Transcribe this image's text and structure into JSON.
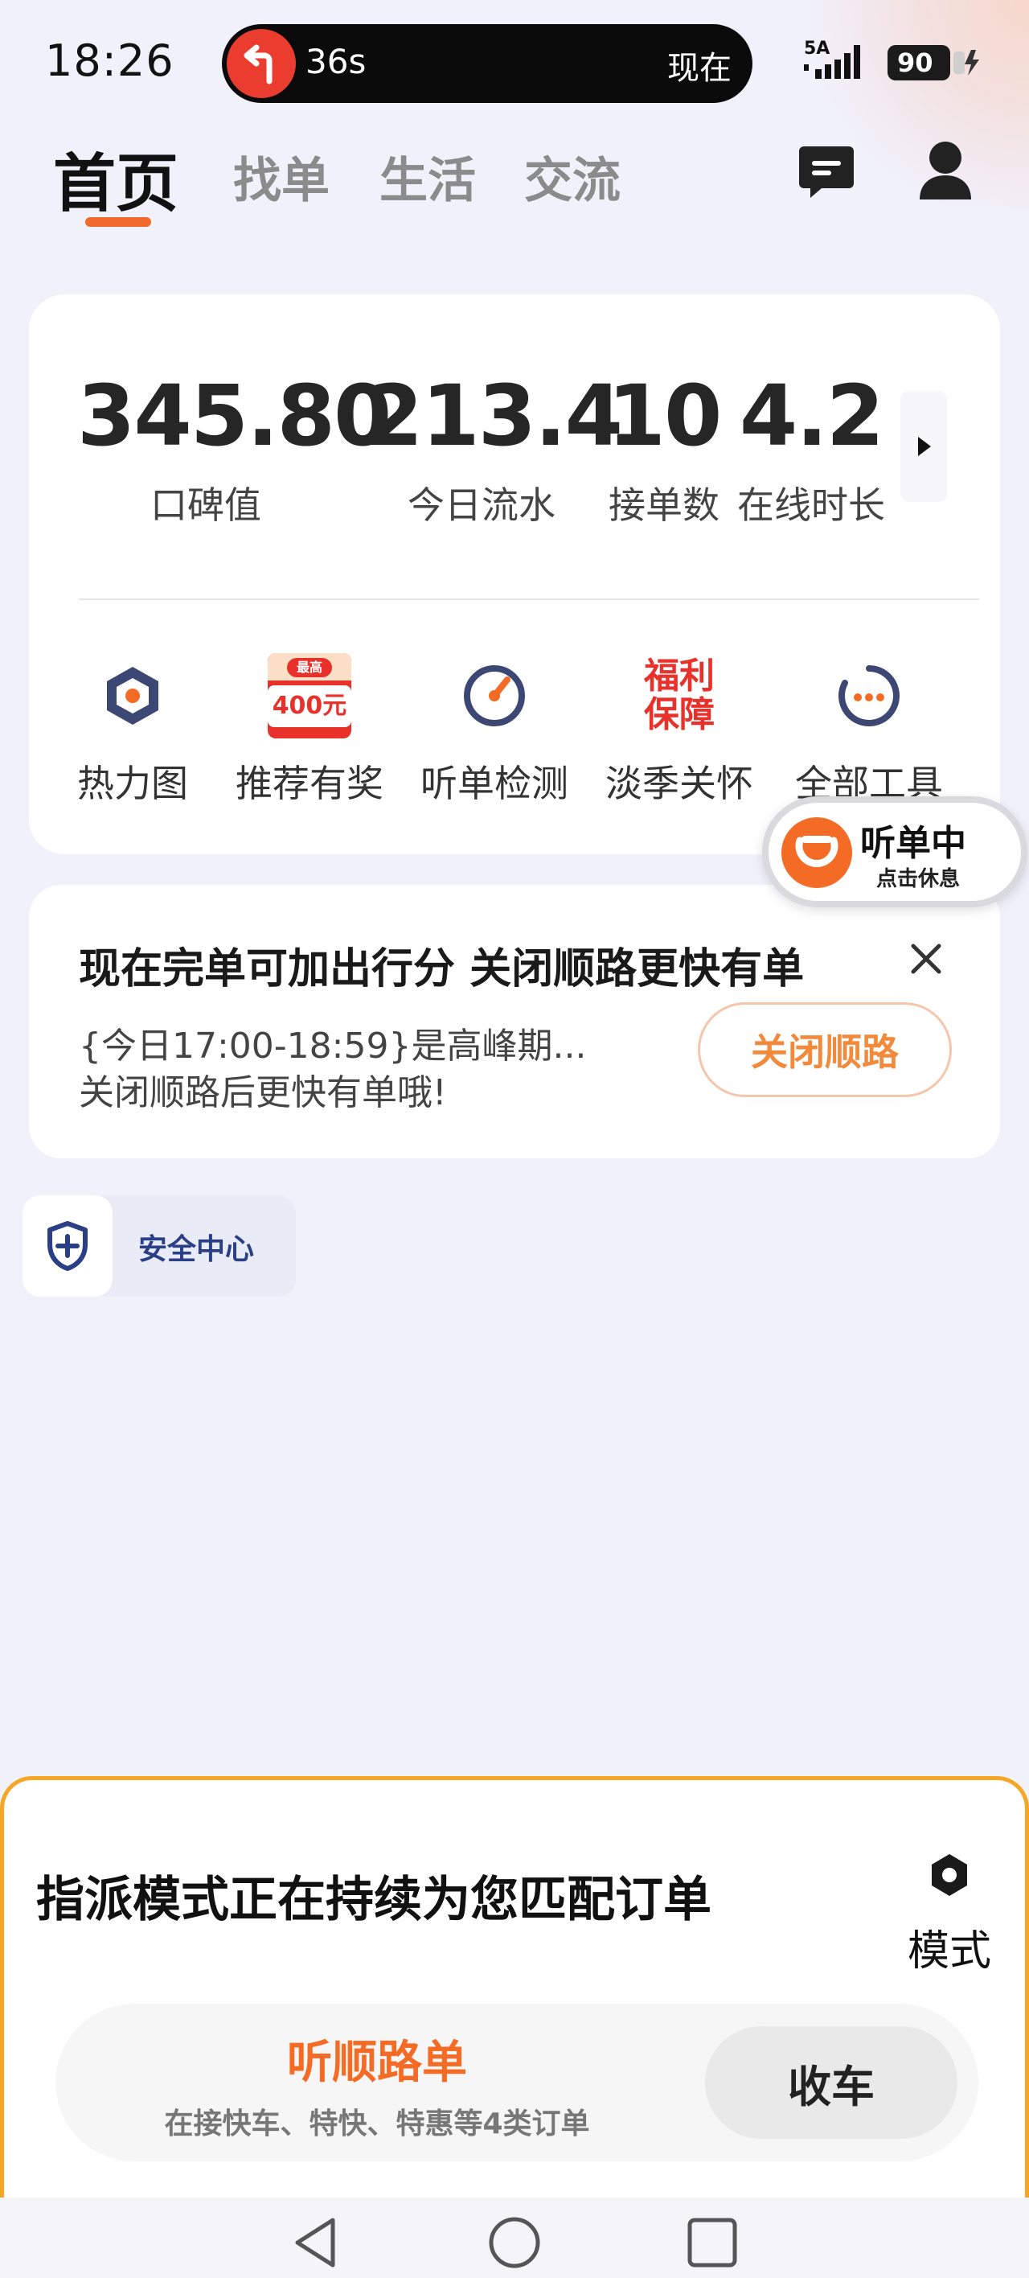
{
  "status_bar": {
    "time": "18:26",
    "nav_eta": "36s",
    "nav_now": "现在",
    "network": "5A",
    "battery": "90"
  },
  "top_nav": {
    "tabs": [
      {
        "label": "首页",
        "active": true
      },
      {
        "label": "找单",
        "active": false
      },
      {
        "label": "生活",
        "active": false
      },
      {
        "label": "交流",
        "active": false
      }
    ]
  },
  "stats": [
    {
      "value": "345.80",
      "label": "口碑值"
    },
    {
      "value": "213.4",
      "label": "今日流水"
    },
    {
      "value": "10",
      "label": "接单数"
    },
    {
      "value": "4.2",
      "label": "在线时长"
    }
  ],
  "tools": [
    {
      "label": "热力图",
      "icon": "heatmap-icon"
    },
    {
      "label": "推荐有奖",
      "icon": "referral-reward-icon",
      "badge_top": "最高",
      "badge_value": "400元"
    },
    {
      "label": "听单检测",
      "icon": "gauge-icon"
    },
    {
      "label": "淡季关怀",
      "icon": "welfare-icon",
      "badge_text": "福利保障"
    },
    {
      "label": "全部工具",
      "icon": "more-dots-icon"
    }
  ],
  "listening": {
    "title": "听单中",
    "subtitle": "点击休息"
  },
  "notice": {
    "title": "现在完单可加出行分 关闭顺路更快有单",
    "line1": "{今日17:00-18:59}是高峰期...",
    "line2": "关闭顺路后更快有单哦!",
    "button": "关闭顺路"
  },
  "safety": {
    "label": "安全中心"
  },
  "dispatch": {
    "title": "指派模式正在持续为您匹配订单",
    "mode_label": "模式",
    "route_title": "听顺路单",
    "route_subtitle": "在接快车、特快、特惠等4类订单",
    "offline_button": "收车"
  },
  "colors": {
    "accent_orange": "#f36b24",
    "panel_border": "#f5a625",
    "background": "#f1f1fb"
  }
}
